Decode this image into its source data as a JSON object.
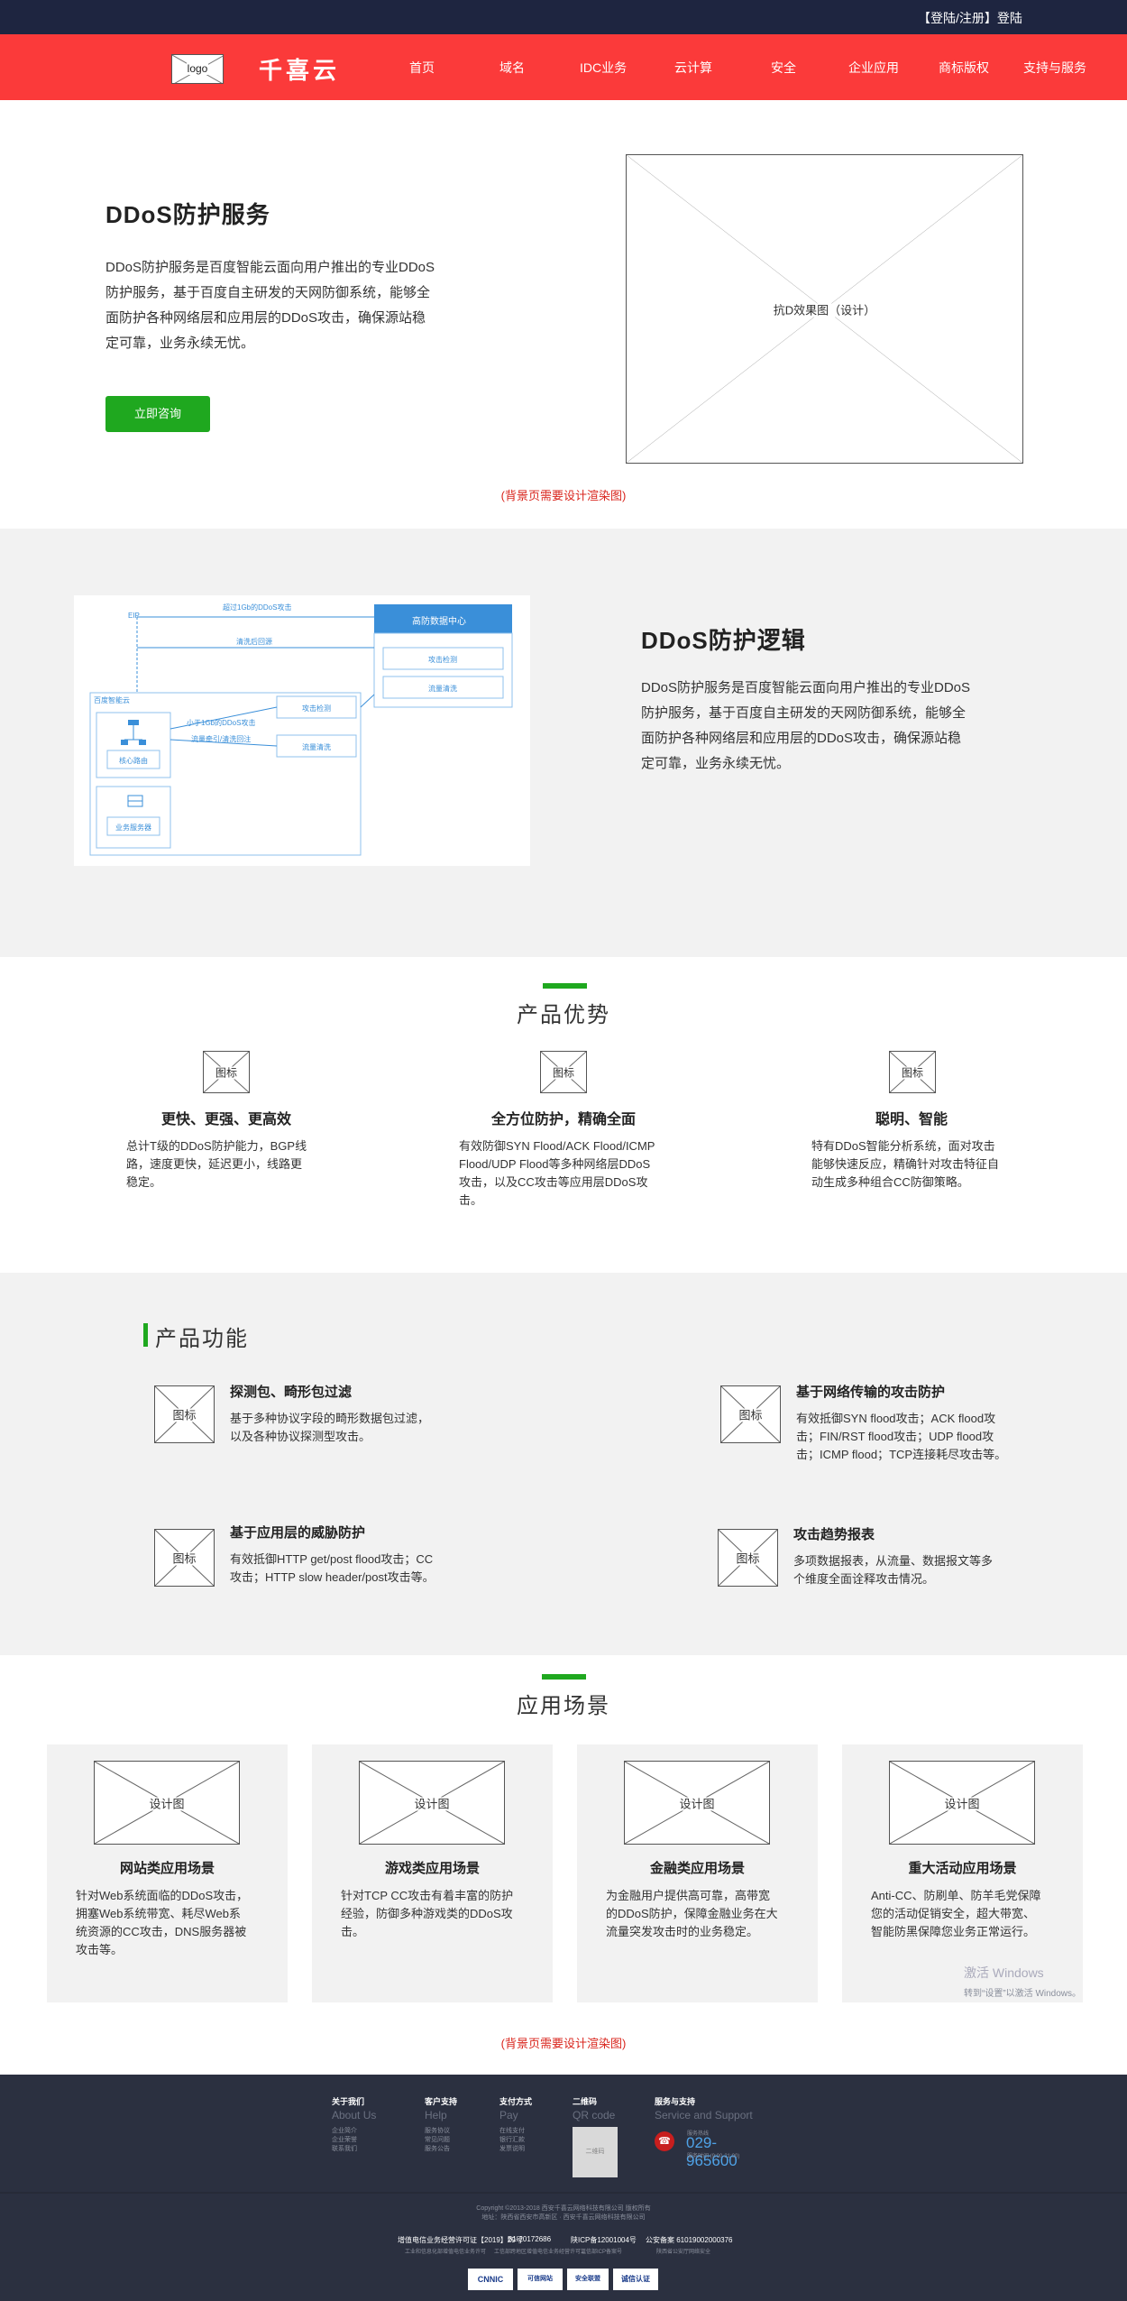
{
  "topbar": {
    "login_text": "【登陆/注册】登陆"
  },
  "nav": {
    "logo_text": "logo",
    "brand": "千喜云",
    "items": [
      "首页",
      "域名",
      "IDC业务",
      "云计算",
      "安全",
      "企业应用",
      "商标版权",
      "支持与服务"
    ]
  },
  "hero": {
    "title": "DDoS防护服务",
    "desc_lines": [
      "DDoS防护服务是百度智能云面向用户推出的专业DDoS",
      "防护服务，基于百度自主研发的天网防御系统，能够全",
      "面防护各种网络层和应用层的DDoS攻击，确保源站稳",
      "定可靠，业务永续无忧。"
    ],
    "button": "立即咨询",
    "image_label": "抗D效果图（设计）",
    "note": "(背景页需要设计渲染图)"
  },
  "logic": {
    "title": "DDoS防护逻辑",
    "desc_lines": [
      "DDoS防护服务是百度智能云面向用户推出的专业DDoS",
      "防护服务，基于百度自主研发的天网防御系统，能够全",
      "面防护各种网络层和应用层的DDoS攻击，确保源站稳",
      "定可靠，业务永续无忧。"
    ],
    "diagram": {
      "ip": "EIP",
      "top_arrow": "超过1Gb的DDoS攻击",
      "clean_back": "清洗后回源",
      "center": "高防数据中心",
      "center_box1": "攻击检测",
      "center_box2": "流量清洗",
      "region": "百度智能云",
      "mid_arrow": "小于1Gb的DDoS攻击",
      "mid_arrow2": "流量牵引/清洗回注",
      "box_attack": "攻击检测",
      "box_clean": "流量清洗",
      "node1": "核心路由",
      "node2": "业务服务器"
    }
  },
  "advantages": {
    "title": "产品优势",
    "icon_label": "图标",
    "items": [
      {
        "title": "更快、更强、更高效",
        "desc_lines": [
          "总计T级的DDoS防护能力，BGP线",
          "路，速度更快，延迟更小，线路更",
          "稳定。"
        ]
      },
      {
        "title": "全方位防护，精确全面",
        "desc_lines": [
          "有效防御SYN Flood/ACK Flood/ICMP",
          "Flood/UDP Flood等多种网络层DDoS",
          "攻击，以及CC攻击等应用层DDoS攻",
          "击。"
        ]
      },
      {
        "title": "聪明、智能",
        "desc_lines": [
          "特有DDoS智能分析系统，面对攻击",
          "能够快速反应，精确针对攻击特征自",
          "动生成多种组合CC防御策略。"
        ]
      }
    ]
  },
  "functions": {
    "title": "产品功能",
    "icon_label": "图标",
    "items": [
      {
        "title": "探测包、畸形包过滤",
        "desc_lines": [
          "基于多种协议字段的畸形数据包过滤，",
          "以及各种协议探测型攻击。"
        ]
      },
      {
        "title": "基于网络传输的攻击防护",
        "desc_lines": [
          "有效抵御SYN flood攻击；ACK flood攻",
          "击；FIN/RST flood攻击；UDP flood攻",
          "击；ICMP flood；TCP连接耗尽攻击等。"
        ]
      },
      {
        "title": "基于应用层的威胁防护",
        "desc_lines": [
          "有效抵御HTTP get/post flood攻击；CC",
          "攻击；HTTP slow header/post攻击等。"
        ]
      },
      {
        "title": "攻击趋势报表",
        "desc_lines": [
          "多项数据报表，从流量、数据报文等多",
          "个维度全面诠释攻击情况。"
        ]
      }
    ]
  },
  "scenes": {
    "title": "应用场景",
    "image_label": "设计图",
    "items": [
      {
        "title": "网站类应用场景",
        "desc_lines": [
          "针对Web系统面临的DDoS攻击，",
          "拥塞Web系统带宽、耗尽Web系",
          "统资源的CC攻击，DNS服务器被",
          "攻击等。"
        ]
      },
      {
        "title": "游戏类应用场景",
        "desc_lines": [
          "针对TCP CC攻击有着丰富的防护",
          "经验，防御多种游戏类的DDoS攻",
          "击。"
        ]
      },
      {
        "title": "金融类应用场景",
        "desc_lines": [
          "为金融用户提供高可靠，高带宽",
          "的DDoS防护，保障金融业务在大",
          "流量突发攻击时的业务稳定。"
        ]
      },
      {
        "title": "重大活动应用场景",
        "desc_lines": [
          "Anti-CC、防刷单、防羊毛党保障",
          "您的活动促销安全，超大带宽、",
          "智能防黑保障您业务正常运行。"
        ]
      }
    ],
    "note": "(背景页需要设计渲染图)"
  },
  "footer": {
    "cols": [
      {
        "h": "关于我们",
        "en": "About Us",
        "links": [
          "企业简介",
          "企业荣誉",
          "联系我们"
        ]
      },
      {
        "h": "客户支持",
        "en": "Help",
        "links": [
          "服务协议",
          "常见问题",
          "服务公告"
        ]
      },
      {
        "h": "支付方式",
        "en": "Pay",
        "links": [
          "在线支付",
          "银行汇款",
          "发票说明"
        ]
      },
      {
        "h": "二维码",
        "en": "QR code",
        "qr_label": "二维码"
      },
      {
        "h": "服务与支持",
        "en": "Service and Support",
        "hotline_label": "服务热线",
        "phone": "029-965600",
        "hours": "服务时间 (9:00-21:00)"
      }
    ],
    "copyright": "Copyright ©2013-2018 西安千喜云网络科技有限公司 版权所有",
    "address": "地址：陕西省西安市高新区 · 西安千喜云网络科技有限公司",
    "regs": [
      {
        "t": "增值电信业务经营许可证【2019】29号",
        "s": "工业和信息化部增值电信业务许可"
      },
      {
        "t": "B1-20172686",
        "s": "工信部跨地区增值电信业务经营许可证"
      },
      {
        "t": "陕ICP备12001004号",
        "s": "工信部ICP备案号"
      },
      {
        "t": "公安备案 61019002000376",
        "s": "陕西省公安厅网络安全"
      }
    ],
    "badges": [
      "CNNIC",
      "可信网站",
      "安全联盟",
      "诚信认证"
    ],
    "windows": {
      "line1": "激活 Windows",
      "line2": "转到“设置”以激活 Windows。"
    }
  }
}
